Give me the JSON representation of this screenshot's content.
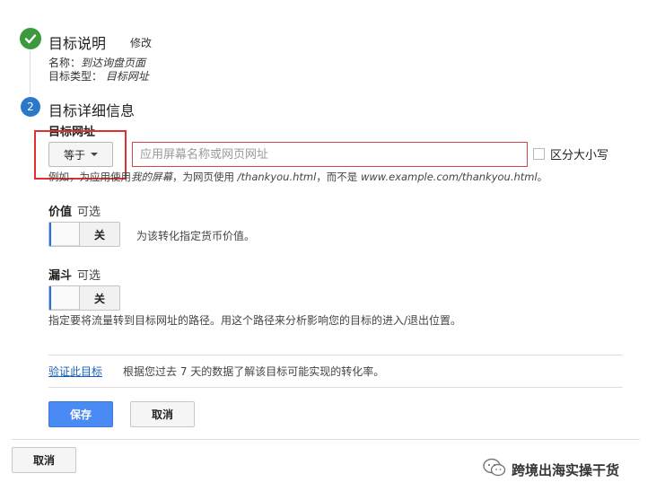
{
  "step1": {
    "title": "目标说明",
    "edit_label": "修改",
    "name_label": "名称：",
    "name_value": "到达询盘页面",
    "type_label": "目标类型：",
    "type_value": "目标网址"
  },
  "step2": {
    "number": "2",
    "title": "目标详细信息",
    "destination": {
      "label": "目标网址",
      "match_type_selected": "等于",
      "input_value": "",
      "input_placeholder": "应用屏幕名称或网页网址",
      "case_sensitive_label": "区分大小写",
      "case_sensitive_checked": false,
      "hint": {
        "prefix": "例如，为应用使用",
        "app_example": "我的屏幕",
        "middle": "，为网页使用",
        "web_example": "/thankyou.html",
        "middle2": "，而不是",
        "bad_example": "www.example.com/thankyou.html",
        "suffix": "。"
      }
    },
    "value": {
      "label": "价值",
      "optional": "可选",
      "toggle_state": "关",
      "description": "为该转化指定货币价值。"
    },
    "funnel": {
      "label": "漏斗",
      "optional": "可选",
      "toggle_state": "关",
      "description": "指定要将流量转到目标网址的路径。用这个路径来分析影响您的目标的进入/退出位置。"
    },
    "verify": {
      "link_label": "验证此目标",
      "description": "根据您过去 7 天的数据了解该目标可能实现的转化率。"
    },
    "save_label": "保存",
    "cancel_label": "取消"
  },
  "footer": {
    "cancel_label": "取消"
  },
  "watermark": {
    "text": "跨境出海实操干货",
    "icon": "wechat-icon"
  },
  "colors": {
    "check_green": "#3c9a3c",
    "step_blue": "#2a78c7",
    "highlight_red": "#e03030",
    "save_blue": "#4a8af4",
    "link_blue": "#1a5fb4"
  }
}
